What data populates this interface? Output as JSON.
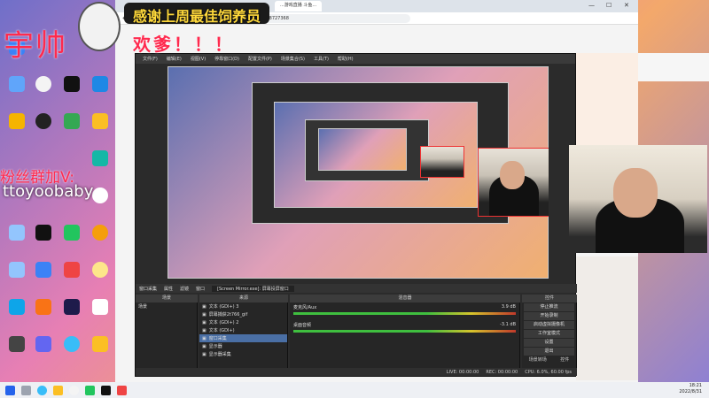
{
  "overlay": {
    "name": "宇帅",
    "thanks": "感谢上周最佳饲养员",
    "blessing": "欢爹！！！",
    "fans_label": "粉丝群加V:",
    "fans_id": "ttoyoobaby"
  },
  "browser": {
    "tab_title": "...游戏直播 斗鱼...",
    "url": "https://www.douyu.com/102956391?_r=0.7567019848727368",
    "win_min": "—",
    "win_max": "☐",
    "win_close": "✕"
  },
  "obs": {
    "menu": [
      "文件(F)",
      "编辑(E)",
      "视图(V)",
      "停靠窗口(D)",
      "配置文件(P)",
      "场景集合(S)",
      "工具(T)",
      "帮助(H)"
    ],
    "source_bar": {
      "source": "窗口采集",
      "properties": "属性",
      "filters": "滤镜",
      "window_label": "窗口",
      "window_value": "[Screen Mirror.exe]: 屏幕投屏窗口"
    },
    "docks": {
      "scenes": "场景",
      "sources": "来源",
      "mixer": "混音器",
      "controls": "控件"
    },
    "scenes": [
      "场景"
    ],
    "sources": [
      {
        "name": "文本 (GDI+) 3",
        "selected": false
      },
      {
        "name": "屏幕捕获2t766_gif",
        "selected": false
      },
      {
        "name": "文本 (GDI+) 2",
        "selected": false
      },
      {
        "name": "文本 (GDI+)",
        "selected": false
      },
      {
        "name": "窗口采集",
        "selected": true
      },
      {
        "name": "显示器",
        "selected": false
      },
      {
        "name": "显示器采集",
        "selected": false
      }
    ],
    "mixer": [
      {
        "name": "麦克风/Aux",
        "db": "3.9 dB"
      },
      {
        "name": "桌面音频",
        "db": "-3.1 dB"
      }
    ],
    "controls": [
      "停止推流",
      "开始录制",
      "启动虚拟摄像机",
      "工作室模式",
      "设置",
      "退出"
    ],
    "controls_footer": [
      "场景转场",
      "控件"
    ],
    "status": [
      "LIVE: 00:00:00",
      "REC: 00:00:00",
      "CPU: 6.0%, 60.00 fps"
    ]
  },
  "clock": {
    "time": "18:21",
    "date": "2022/8/31"
  },
  "colors": {
    "accent_red": "#ff2a4e",
    "gold": "#ffd93b",
    "obs_bg": "#2b2b2b"
  }
}
